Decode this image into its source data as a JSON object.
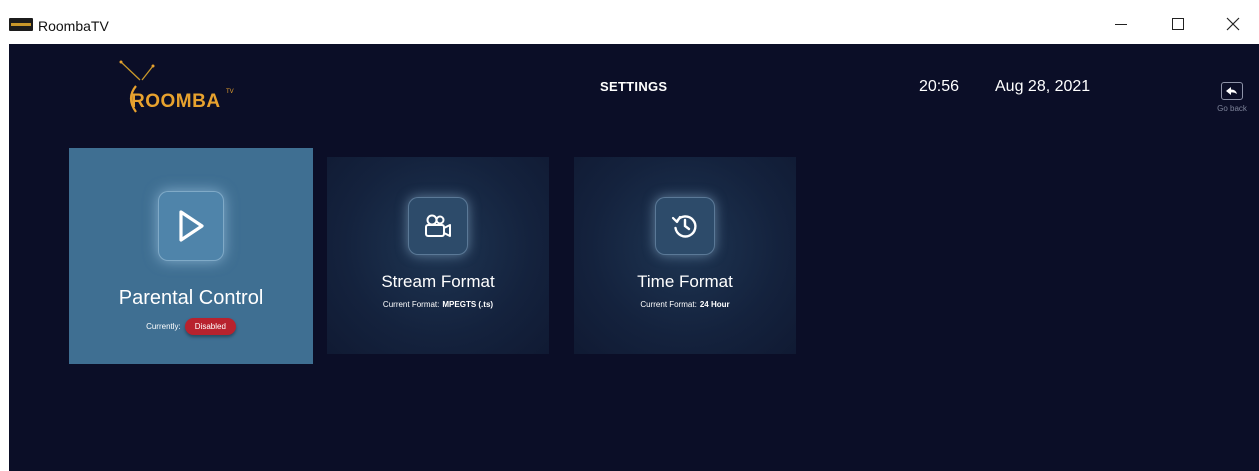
{
  "window": {
    "title": "RoombaTV",
    "minimize_icon": "minimize-icon",
    "maximize_icon": "maximize-icon",
    "close_icon": "close-icon"
  },
  "header": {
    "logo_text": "ROOMBA",
    "logo_tv": "TV",
    "page_title": "SETTINGS",
    "time": "20:56",
    "date": "Aug 28, 2021",
    "go_back_label": "Go back",
    "go_back_icon": "back-arrow-icon"
  },
  "tiles": [
    {
      "name": "Parental Control",
      "icon": "play-icon",
      "sub_label": "Currently:",
      "status": "Disabled",
      "status_color": "#b8222e",
      "background": "#3f6f92"
    },
    {
      "name": "Stream Format",
      "icon": "video-camera-icon",
      "sub_label": "Current Format:",
      "sub_value": "MPEGTS (.ts)"
    },
    {
      "name": "Time Format",
      "icon": "history-clock-icon",
      "sub_label": "Current Format:",
      "sub_value": "24 Hour"
    }
  ],
  "colors": {
    "background": "#0b0e27",
    "accent": "#e8a22e"
  }
}
